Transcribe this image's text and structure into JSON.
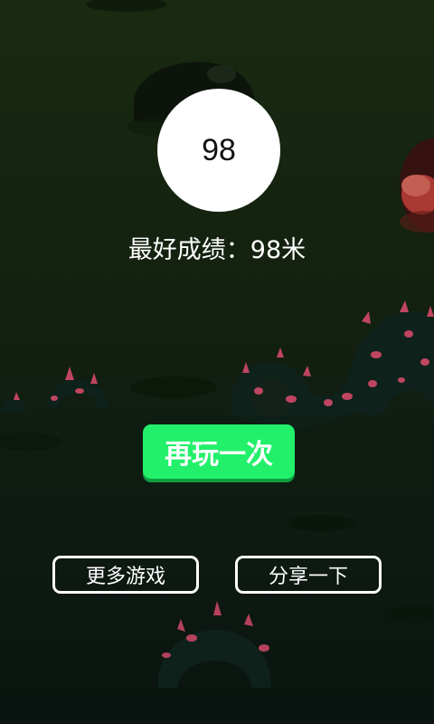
{
  "score": "98",
  "best_score_text": "最好成绩：98米",
  "buttons": {
    "replay": "再玩一次",
    "more_games": "更多游戏",
    "share": "分享一下"
  },
  "colors": {
    "background_top": "#1a2a10",
    "background_bottom": "#0a1410",
    "replay_button": "#22f06a",
    "score_circle": "#ffffff",
    "text": "#ffffff"
  },
  "background_decor": [
    "dark-blob",
    "red-creature",
    "spiky-serpent",
    "spiky-serpent-small",
    "spiky-ring-bottom",
    "shadow-puddles"
  ]
}
